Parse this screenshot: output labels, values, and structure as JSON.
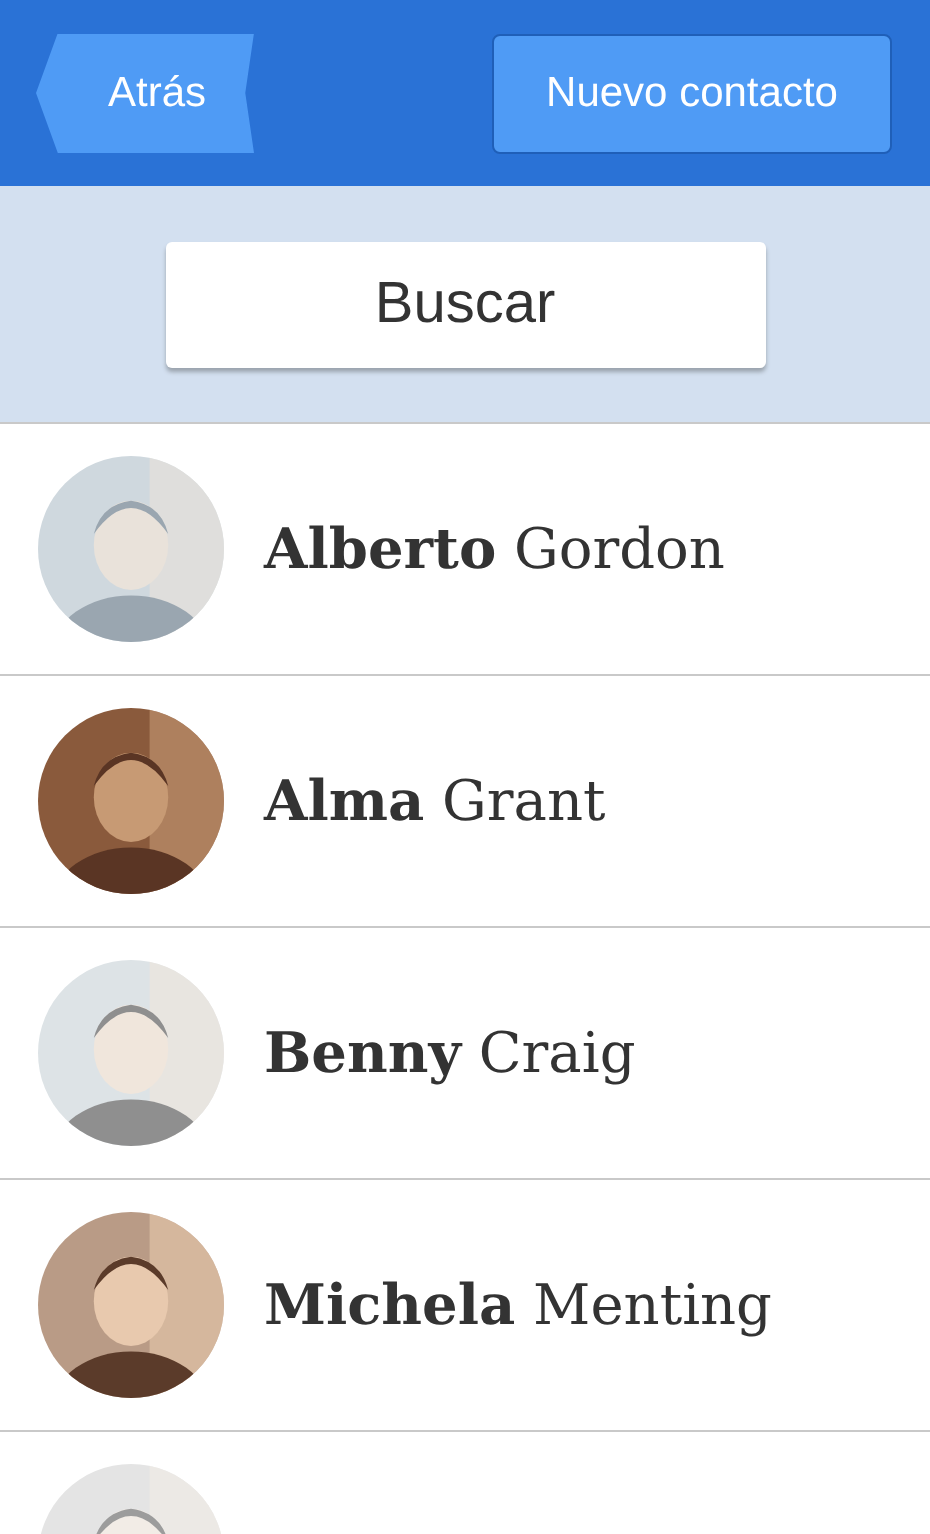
{
  "header": {
    "back_button": "Atrás",
    "new_contact_button": "Nuevo contacto"
  },
  "search_button": "Buscar",
  "contacts": [
    {
      "name": "**Alberto** Gordon",
      "avatar": {
        "kind": "picture"
      }
    },
    {
      "name": "**Alma** Grant",
      "avatar": {
        "kind": "picture"
      }
    },
    {
      "name": "**Benny** Craig",
      "avatar": {
        "kind": "picture"
      }
    },
    {
      "name": "**Michela** Menting",
      "avatar": {
        "kind": "picture"
      }
    },
    {
      "avatar": {
        "kind": "picture"
      }
    }
  ]
}
